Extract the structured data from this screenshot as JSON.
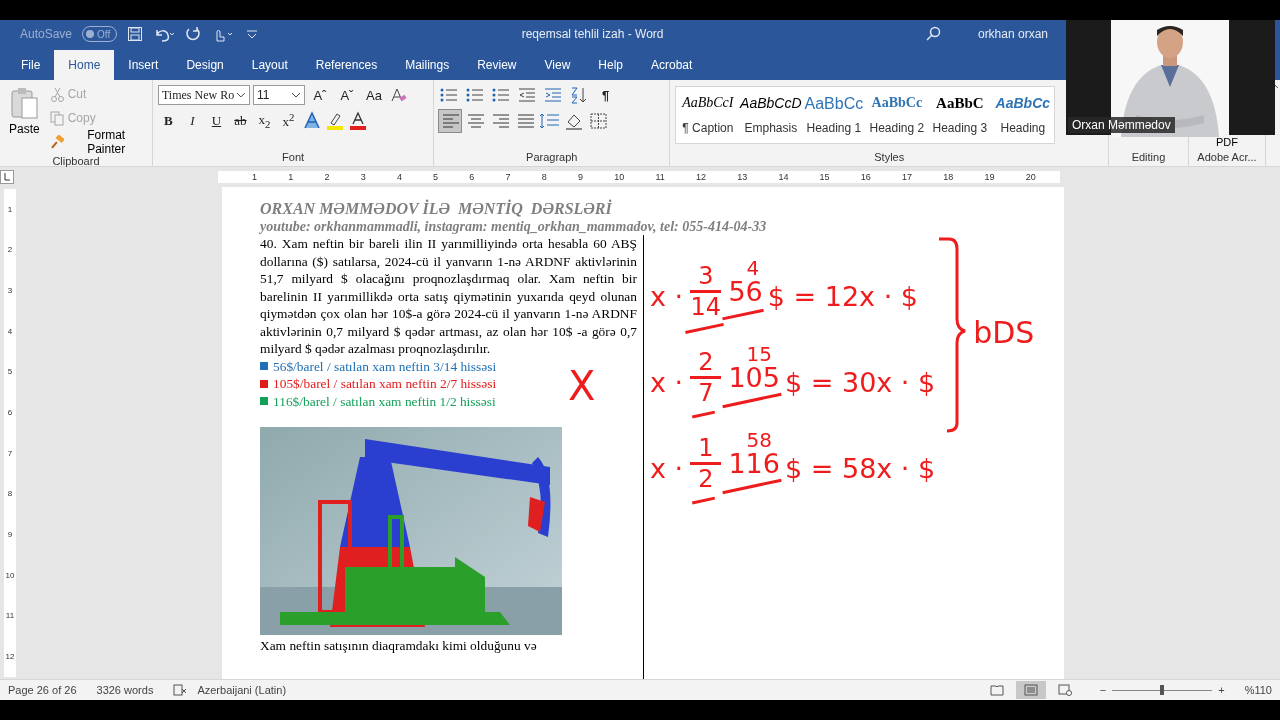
{
  "title_bar": {
    "autosave_label": "AutoSave",
    "autosave_state": "Off",
    "autosave_on": false,
    "document_title": "reqemsal tehlil izah  -  Word",
    "user": "orkhan orxan"
  },
  "menu_tabs": [
    {
      "label": "File",
      "selected": false
    },
    {
      "label": "Home",
      "selected": true
    },
    {
      "label": "Insert",
      "selected": false
    },
    {
      "label": "Design",
      "selected": false
    },
    {
      "label": "Layout",
      "selected": false
    },
    {
      "label": "References",
      "selected": false
    },
    {
      "label": "Mailings",
      "selected": false
    },
    {
      "label": "Review",
      "selected": false
    },
    {
      "label": "View",
      "selected": false
    },
    {
      "label": "Help",
      "selected": false
    },
    {
      "label": "Acrobat",
      "selected": false
    }
  ],
  "clipboard": {
    "paste": "Paste",
    "tools": [
      {
        "label": "Cut",
        "kind": "cut",
        "disabled": true
      },
      {
        "label": "Copy",
        "kind": "copy",
        "disabled": true
      },
      {
        "label": "Format Painter",
        "kind": "painter",
        "disabled": false
      }
    ],
    "group": "Clipboard"
  },
  "font": {
    "name": "Times New Ro",
    "size": "11",
    "size_tools": [
      "Aˆ",
      "Aˇ",
      "Aa"
    ],
    "format_buttons": [
      {
        "label": "B",
        "kind": "bold"
      },
      {
        "label": "I",
        "kind": "italic"
      },
      {
        "label": "U",
        "kind": "underline"
      },
      {
        "label": "ab",
        "kind": "strike"
      },
      {
        "label": "x$_{2}$",
        "kind": "plain"
      },
      {
        "label": "x$^{2}$",
        "kind": "plain"
      }
    ],
    "group": "Font"
  },
  "paragraph": {
    "pilcrow": "¶",
    "alignment": [
      {
        "kind": "left",
        "selected": true
      },
      {
        "kind": "center",
        "selected": false
      },
      {
        "kind": "right",
        "selected": false
      },
      {
        "kind": "justify",
        "selected": false
      }
    ],
    "group": "Paragraph"
  },
  "styles": {
    "items": [
      {
        "sample": "AaBbCcI",
        "label": "¶ Caption",
        "kind": "caption"
      },
      {
        "sample": "AaBbCcD",
        "label": "Emphasis",
        "kind": "emphasis"
      },
      {
        "sample": "AaBbCc",
        "label": "Heading 1",
        "kind": "heading1"
      },
      {
        "sample": "AaBbCc",
        "label": "Heading 2",
        "kind": "heading2"
      },
      {
        "sample": "AaBbC",
        "label": "Heading 3",
        "kind": "heading3"
      },
      {
        "sample": "AaBbCc",
        "label": "Heading",
        "kind": "heading4"
      }
    ],
    "group": "Styles"
  },
  "editing": {
    "group": "Editing"
  },
  "adobe": {
    "button": "PDF",
    "group": "Adobe Acr..."
  },
  "ruler": {
    "horizontal": [
      "1",
      "1",
      "2",
      "3",
      "4",
      "5",
      "6",
      "7",
      "8",
      "9",
      "10",
      "11",
      "12",
      "13",
      "14",
      "15",
      "16",
      "17",
      "18",
      "19",
      "20"
    ],
    "vertical": [
      "1",
      "2",
      "3",
      "4",
      "5",
      "6",
      "7",
      "8",
      "9",
      "10",
      "11",
      "12"
    ]
  },
  "document": {
    "header_title": "ORXAN MƏMMƏDOV İLƏ  MƏNTİQ  DƏRSLƏRİ",
    "header_contacts": "youtube: orkhanmammadli, instagram: mentiq_orkhan_mammadov, tel: 055-414-04-33",
    "question": "40. Xam neftin bir bareli ilin II yarımilliyində orta hesabla 60 ABŞ dollarına ($) satılarsa, 2024-cü il yanvarın 1-nə ARDNF aktivlərinin 51,7 milyard $ olacağını proqnozlaşdırmaq olar. Xam neftin bir barelinin II yarımillikdə orta satış qiymətinin yuxarıda qeyd olunan qiymətdən çox olan hər 10$-a görə 2024-cü il yanvarın 1-nə ARDNF aktivlərinin 0,7 milyard $ qədər artması, az olan hər 10$ -a görə 0,7 milyard $ qədər azalması proqnozlaşdırılır.",
    "legend": [
      {
        "text": "56$/barel / satılan xam neftin 3/14 hissəsi",
        "color": "#1f6fb4"
      },
      {
        "text": "105$/barel / satılan xam neftin 2/7 hissəsi",
        "color": "#e31b1b"
      },
      {
        "text": "116$/barel / satılan xam neftin 1/2 hissəsi",
        "color": "#14a05a"
      }
    ],
    "after_figure": "Xam neftin satışının diaqramdakı kimi olduğunu və"
  },
  "ink": {
    "mark": "X",
    "equations": [
      {
        "lhs": "x ·",
        "num": "3",
        "den": "14",
        "den_struck": true,
        "note": "4",
        "factor": "56",
        "rhs": "$ = 12x · $"
      },
      {
        "lhs": "x ·",
        "num": "2",
        "den": "7",
        "den_struck": true,
        "note": "15",
        "factor": "105",
        "rhs": "$ = 30x · $"
      },
      {
        "lhs": "x ·",
        "num": "1",
        "den": "2",
        "den_struck": true,
        "note": "58",
        "factor": "116",
        "rhs": "$ = 58x · $"
      }
    ],
    "brace_note": "bDS"
  },
  "status_bar": {
    "page": "Page 26 of 26",
    "words": "3326 words",
    "language": "Azerbaijani (Latin)",
    "zoom": "%110",
    "zoom_minus": "−",
    "zoom_plus": "+",
    "zoom_slider": {
      "level": 0.5
    },
    "views": [
      {
        "kind": "read",
        "selected": false
      },
      {
        "kind": "print",
        "selected": true
      },
      {
        "kind": "web",
        "selected": false
      }
    ]
  },
  "webcam": {
    "name": "Orxan Məmmədov"
  }
}
